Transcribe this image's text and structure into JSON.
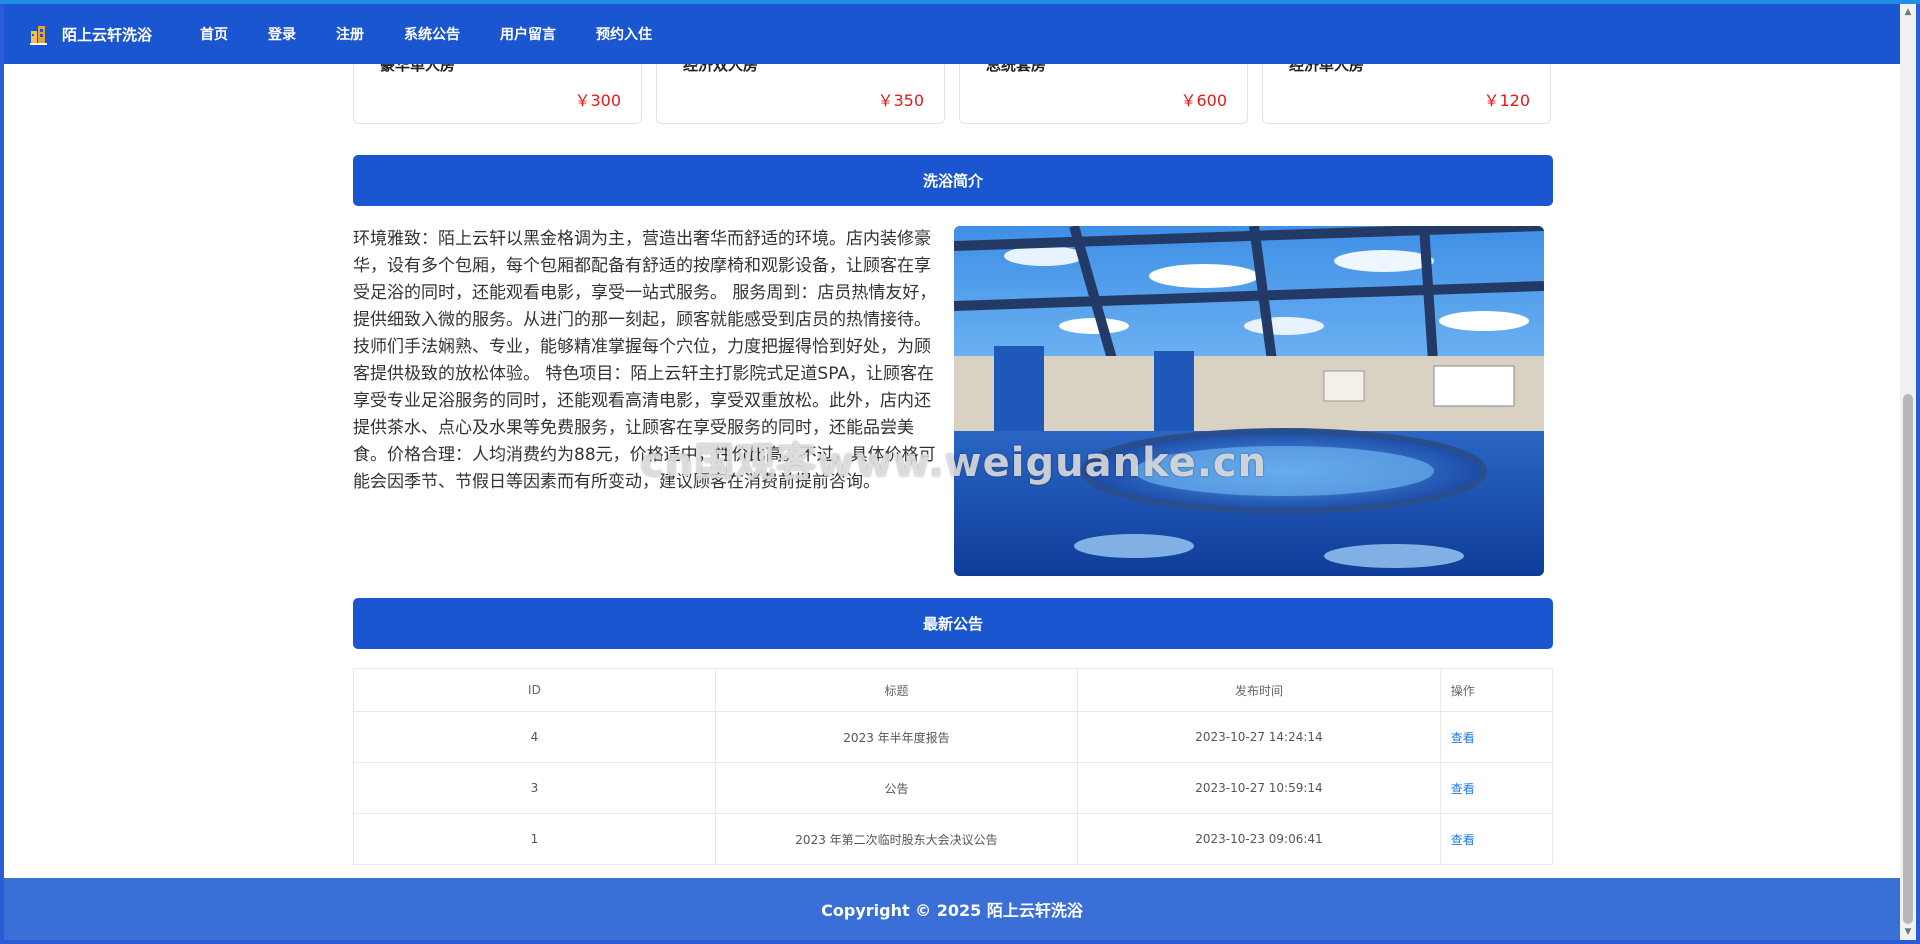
{
  "brand": {
    "name": "陌上云轩洗浴",
    "logo_icon": "building-logo-icon"
  },
  "nav": {
    "items": [
      {
        "label": "首页"
      },
      {
        "label": "登录"
      },
      {
        "label": "注册"
      },
      {
        "label": "系统公告"
      },
      {
        "label": "用户留言"
      },
      {
        "label": "预约入住"
      }
    ]
  },
  "rooms": [
    {
      "name": "豪华单人房",
      "price": "￥300"
    },
    {
      "name": "经济双人房",
      "price": "￥350"
    },
    {
      "name": "总统套房",
      "price": "￥600"
    },
    {
      "name": "经济单人房",
      "price": "￥120"
    }
  ],
  "intro": {
    "title": "洗浴简介",
    "text": "环境雅致：陌上云轩以黑金格调为主，营造出奢华而舒适的环境。店内装修豪华，设有多个包厢，每个包厢都配备有舒适的按摩椅和观影设备，让顾客在享受足浴的同时，还能观看电影，享受一站式服务。 服务周到：店员热情友好，提供细致入微的服务。从进门的那一刻起，顾客就能感受到店员的热情接待。技师们手法娴熟、专业，能够精准掌握每个穴位，力度把握得恰到好处，为顾客提供极致的放松体验。 特色项目：陌上云轩主打影院式足道SPA，让顾客在享受专业足浴服务的同时，还能观看高清电影，享受双重放松。此外，店内还提供茶水、点心及水果等免费服务，让顾客在享受服务的同时，还能品尝美食。价格合理：人均消费约为88元，价格适中，性价比高。不过，具体价格可能会因季节、节假日等因素而有所变动，建议顾客在消费前提前咨询。"
  },
  "notices": {
    "title": "最新公告",
    "headers": {
      "id": "ID",
      "title": "标题",
      "time": "发布时间",
      "op": "操作"
    },
    "rows": [
      {
        "id": "4",
        "title": "2023 年半年度报告",
        "time": "2023-10-27 14:24:14",
        "op": "查看"
      },
      {
        "id": "3",
        "title": "公告",
        "time": "2023-10-27 10:59:14",
        "op": "查看"
      },
      {
        "id": "1",
        "title": "2023 年第二次临时股东大会决议公告",
        "time": "2023-10-23 09:06:41",
        "op": "查看"
      }
    ]
  },
  "footer": {
    "text": "Copyright © 2025 陌上云轩洗浴"
  },
  "watermark": {
    "text": "cn国观客www.weiguanke.cn"
  },
  "colors": {
    "primary": "#1a56d0",
    "price": "#e81818",
    "link": "#1e7be6",
    "footer": "#3a6fd8"
  }
}
